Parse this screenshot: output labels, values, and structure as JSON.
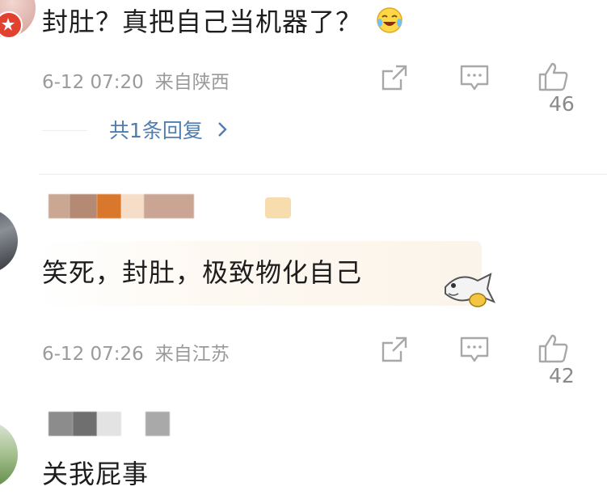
{
  "comments": [
    {
      "text": "封肚？真把自己当机器了？",
      "time": "6-12 07:20",
      "location": "来自陕西",
      "likes": "46",
      "replies_label": "共1条回复",
      "emoji_icon": "laugh-cry-emoji-icon"
    },
    {
      "text": "笑死，封肚，极致物化自己",
      "time": "6-12 07:26",
      "location": "来自江苏",
      "likes": "42",
      "sticker_icon": "fish-sticker-icon"
    },
    {
      "text": "关我屁事"
    }
  ],
  "colors": {
    "reply_link": "#507daf",
    "meta_text": "#9a9a9a",
    "divider": "#ececec"
  }
}
